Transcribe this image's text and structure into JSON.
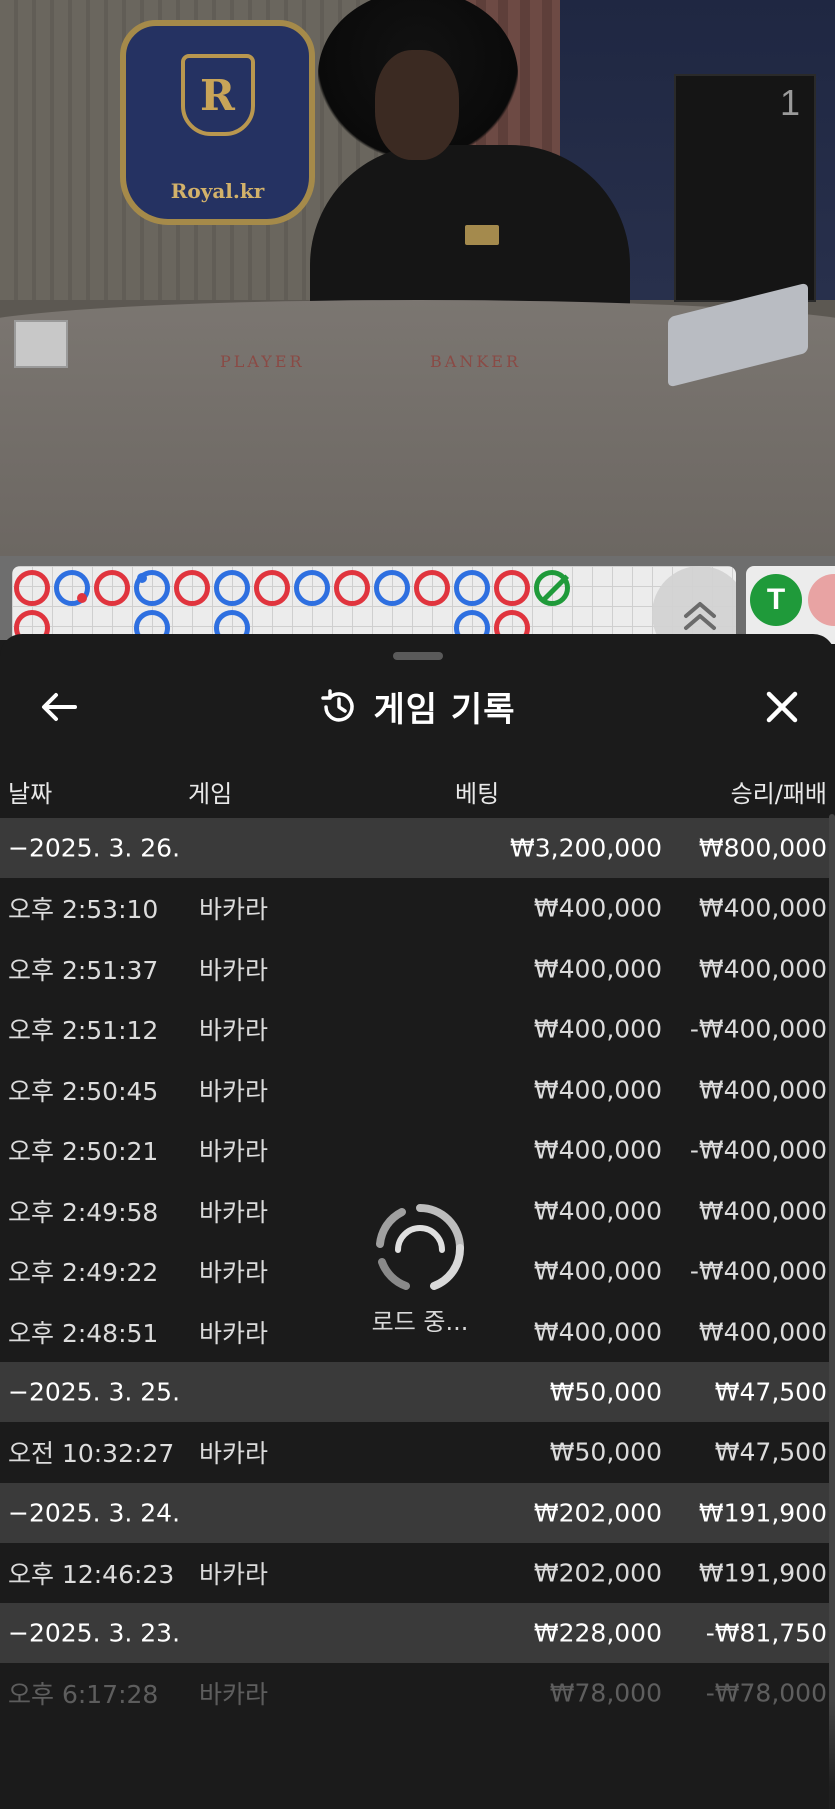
{
  "video": {
    "sign_text": "Royal.kr",
    "crest_letter": "R",
    "table_label_player": "PLAYER",
    "table_label_banker": "BANKER",
    "monitor_number": "1"
  },
  "roadmap": {
    "beads": [
      "B",
      "P",
      "B",
      "P",
      "B",
      "P",
      "B",
      "P",
      "B",
      "P",
      "B",
      "P",
      "B",
      "T"
    ],
    "beads_second_row": [
      "B",
      "",
      "",
      "P",
      "",
      "P",
      "",
      "",
      "",
      "",
      "",
      "P",
      "B",
      ""
    ],
    "expand_icon": "double-chevron-up-icon",
    "side_tie_label": "T"
  },
  "sheet": {
    "title": "게임 기록",
    "back_icon": "arrow-left-icon",
    "history_icon": "history-clock-icon",
    "close_icon": "close-x-icon",
    "columns": {
      "date": "날짜",
      "game": "게임",
      "bet": "베팅",
      "winloss": "승리/패배"
    },
    "rows": [
      {
        "type": "date",
        "time": "−2025. 3. 26.",
        "game": "",
        "bet": "₩3,200,000",
        "winloss": "₩800,000"
      },
      {
        "type": "entry",
        "time": "오후 2:53:10",
        "game": "바카라",
        "bet": "₩400,000",
        "winloss": "₩400,000"
      },
      {
        "type": "entry",
        "time": "오후 2:51:37",
        "game": "바카라",
        "bet": "₩400,000",
        "winloss": "₩400,000"
      },
      {
        "type": "entry",
        "time": "오후 2:51:12",
        "game": "바카라",
        "bet": "₩400,000",
        "winloss": "-₩400,000"
      },
      {
        "type": "entry",
        "time": "오후 2:50:45",
        "game": "바카라",
        "bet": "₩400,000",
        "winloss": "₩400,000"
      },
      {
        "type": "entry",
        "time": "오후 2:50:21",
        "game": "바카라",
        "bet": "₩400,000",
        "winloss": "-₩400,000"
      },
      {
        "type": "entry",
        "time": "오후 2:49:58",
        "game": "바카라",
        "bet": "₩400,000",
        "winloss": "₩400,000"
      },
      {
        "type": "entry",
        "time": "오후 2:49:22",
        "game": "바카라",
        "bet": "₩400,000",
        "winloss": "-₩400,000"
      },
      {
        "type": "entry",
        "time": "오후 2:48:51",
        "game": "바카라",
        "bet": "₩400,000",
        "winloss": "₩400,000"
      },
      {
        "type": "date",
        "time": "−2025. 3. 25.",
        "game": "",
        "bet": "₩50,000",
        "winloss": "₩47,500"
      },
      {
        "type": "entry",
        "time": "오전 10:32:27",
        "game": "바카라",
        "bet": "₩50,000",
        "winloss": "₩47,500"
      },
      {
        "type": "date",
        "time": "−2025. 3. 24.",
        "game": "",
        "bet": "₩202,000",
        "winloss": "₩191,900"
      },
      {
        "type": "entry",
        "time": "오후 12:46:23",
        "game": "바카라",
        "bet": "₩202,000",
        "winloss": "₩191,900"
      },
      {
        "type": "date",
        "time": "−2025. 3. 23.",
        "game": "",
        "bet": "₩228,000",
        "winloss": "-₩81,750"
      },
      {
        "type": "entry",
        "time": "오후 6:17:28",
        "game": "바카라",
        "bet": "₩78,000",
        "winloss": "-₩78,000",
        "faded": true
      }
    ],
    "loading_text": "로드 중..."
  },
  "colors": {
    "sheet_bg": "#1b1b1b",
    "date_row_bg": "#3a3a3a",
    "player_blue": "#2e6fe0",
    "banker_red": "#e0343e",
    "tie_green": "#1f9a3a"
  }
}
